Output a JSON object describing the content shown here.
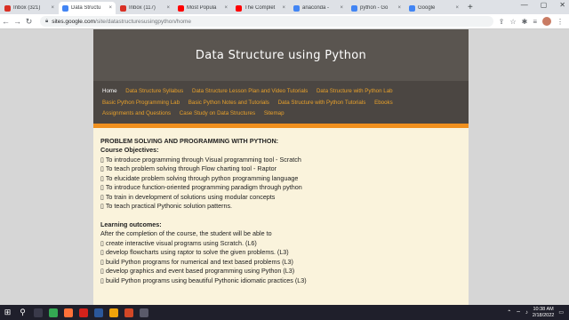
{
  "browser": {
    "tabs": [
      {
        "title": "Inbox (321)",
        "favicon_color": "#d93025"
      },
      {
        "title": "Data Structu",
        "favicon_color": "#4285f4",
        "active": true
      },
      {
        "title": "Inbox (117)",
        "favicon_color": "#d93025"
      },
      {
        "title": "Most Popula",
        "favicon_color": "#ff0000"
      },
      {
        "title": "The Complet",
        "favicon_color": "#ff0000"
      },
      {
        "title": "anaconda -",
        "favicon_color": "#4285f4"
      },
      {
        "title": "python - Go",
        "favicon_color": "#4285f4"
      },
      {
        "title": "Google",
        "favicon_color": "#4285f4"
      }
    ],
    "tab_close": "×",
    "new_tab": "+",
    "window_controls": {
      "minimize": "—",
      "maximize": "▢",
      "close": "✕"
    },
    "nav": {
      "back": "←",
      "forward": "→",
      "reload": "↻"
    },
    "url_host": "sites.google.com",
    "url_path": "/site/datastructuresusingpython/home"
  },
  "site": {
    "title": "Data Structure using Python",
    "nav": [
      "Home",
      "Data Structure Syllabus",
      "Data Structure Lesson Plan and Video Tutorials",
      "Data Structure with Python Lab",
      "Basic Python Programming Lab",
      "Basic Python Notes and Tutorials",
      "Data Structure with Python Tutorials",
      "Ebooks",
      "Assignments and Questions",
      "Case Study on Data Structures",
      "Sitemap"
    ],
    "heading": "PROBLEM SOLVING AND PROGRAMMING WITH PYTHON:",
    "objectives_heading": "Course Objectives:",
    "objectives": [
      "▯ To introduce programming through Visual programming tool - Scratch",
      "▯ To teach problem solving through Flow charting tool - Raptor",
      "▯ To elucidate problem solving through python programming language",
      "▯ To introduce function-oriented programming paradigm through python",
      "▯ To train in development of solutions using modular concepts",
      "▯ To teach practical Pythonic solution patterns."
    ],
    "outcomes_heading": "Learning outcomes:",
    "outcomes_intro": "After the completion of the course, the student will be able to",
    "outcomes": [
      "▯ create interactive visual programs using Scratch. (L6)",
      "▯ develop flowcharts using raptor to solve the given problems. (L3)",
      "▯ build Python programs for numerical and text based problems (L3)",
      "▯ develop graphics and event based programming using Python (L3)",
      "▯ build Python programs using beautiful Pythonic idiomatic practices (L3)"
    ]
  },
  "taskbar": {
    "start": "⊞",
    "search": "⚲",
    "apps": [
      {
        "name": "task-view",
        "color": "#3a3a4a"
      },
      {
        "name": "chrome",
        "color": "#34a853"
      },
      {
        "name": "firefox",
        "color": "#ff7139"
      },
      {
        "name": "acrobat",
        "color": "#d4221b"
      },
      {
        "name": "word",
        "color": "#2b579a"
      },
      {
        "name": "app",
        "color": "#f0a30a"
      },
      {
        "name": "powerpoint",
        "color": "#d24726"
      },
      {
        "name": "settings",
        "color": "#5a5a6a"
      }
    ],
    "time": "10:38 AM",
    "date": "2/18/2022"
  }
}
